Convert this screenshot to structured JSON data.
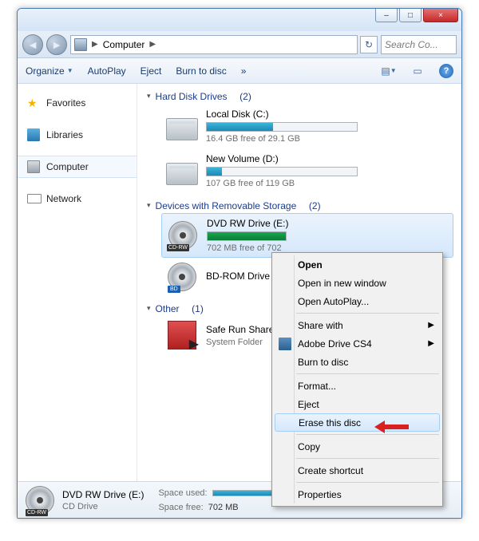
{
  "titlebar": {
    "minimize": "–",
    "maximize": "□",
    "close": "×"
  },
  "addrbar": {
    "location": "Computer",
    "sep": "▶",
    "refresh_icon": "↻",
    "search_placeholder": "Search Co..."
  },
  "toolbar": {
    "organize": "Organize",
    "autoplay": "AutoPlay",
    "eject": "Eject",
    "burn": "Burn to disc",
    "more": "»",
    "view_icon": "▤",
    "preview_icon": "▭",
    "help_icon": "?"
  },
  "sidebar": {
    "favorites": "Favorites",
    "libraries": "Libraries",
    "computer": "Computer",
    "network": "Network"
  },
  "groups": {
    "hdd": {
      "label": "Hard Disk Drives",
      "count": "(2)"
    },
    "removable": {
      "label": "Devices with Removable Storage",
      "count": "(2)"
    },
    "other": {
      "label": "Other",
      "count": "(1)"
    }
  },
  "drives": {
    "c": {
      "title": "Local Disk (C:)",
      "sub": "16.4 GB free of 29.1 GB",
      "fill_pct": 44
    },
    "d": {
      "title": "New Volume (D:)",
      "sub": "107 GB free of 119 GB",
      "fill_pct": 10
    },
    "e": {
      "title": "DVD RW Drive (E:)",
      "sub": "702 MB free of 702",
      "badge": "CD-RW",
      "fill_pct": 100
    },
    "g": {
      "title": "BD-ROM Drive (G:)",
      "badge": "BD"
    },
    "srf": {
      "title": "Safe Run Shared Fo",
      "sub": "System Folder"
    }
  },
  "context_menu": {
    "open": "Open",
    "new_window": "Open in new window",
    "autoplay": "Open AutoPlay...",
    "share": "Share with",
    "adobe": "Adobe Drive CS4",
    "burn": "Burn to disc",
    "format": "Format...",
    "eject": "Eject",
    "erase": "Erase this disc",
    "copy": "Copy",
    "shortcut": "Create shortcut",
    "properties": "Properties",
    "submenu_arrow": "▶"
  },
  "statusbar": {
    "name": "DVD RW Drive (E:)",
    "type": "CD Drive",
    "used_label": "Space used:",
    "free_label": "Space free:",
    "free_value": "702 MB"
  }
}
